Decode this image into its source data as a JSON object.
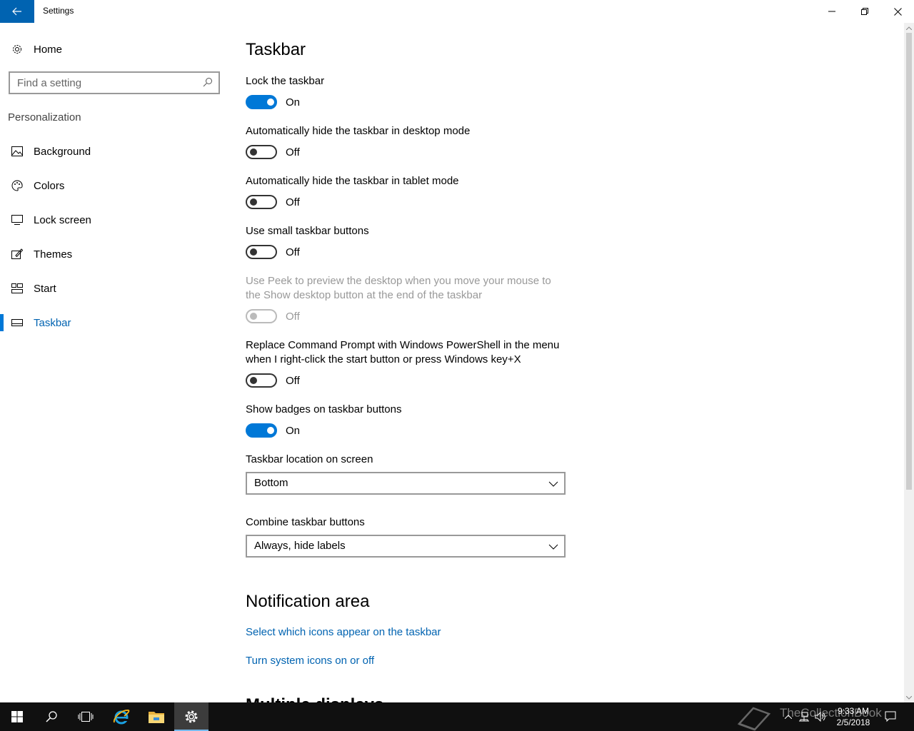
{
  "window": {
    "title": "Settings"
  },
  "sidebar": {
    "home_label": "Home",
    "search_placeholder": "Find a setting",
    "section_label": "Personalization",
    "items": [
      {
        "label": "Background",
        "icon": "image-icon"
      },
      {
        "label": "Colors",
        "icon": "palette-icon"
      },
      {
        "label": "Lock screen",
        "icon": "lock-screen-icon"
      },
      {
        "label": "Themes",
        "icon": "themes-icon"
      },
      {
        "label": "Start",
        "icon": "start-layout-icon"
      },
      {
        "label": "Taskbar",
        "icon": "taskbar-icon",
        "selected": true
      }
    ]
  },
  "main": {
    "title": "Taskbar",
    "settings": [
      {
        "label": "Lock the taskbar",
        "state": "On",
        "on": true
      },
      {
        "label": "Automatically hide the taskbar in desktop mode",
        "state": "Off",
        "on": false
      },
      {
        "label": "Automatically hide the taskbar in tablet mode",
        "state": "Off",
        "on": false
      },
      {
        "label": "Use small taskbar buttons",
        "state": "Off",
        "on": false
      },
      {
        "label": "Use Peek to preview the desktop when you move your mouse to the Show desktop button at the end of the taskbar",
        "state": "Off",
        "on": false,
        "disabled": true
      },
      {
        "label": "Replace Command Prompt with Windows PowerShell in the menu when I right-click the start button or press Windows key+X",
        "state": "Off",
        "on": false
      },
      {
        "label": "Show badges on taskbar buttons",
        "state": "On",
        "on": true
      }
    ],
    "location": {
      "label": "Taskbar location on screen",
      "value": "Bottom"
    },
    "combine": {
      "label": "Combine taskbar buttons",
      "value": "Always, hide labels"
    },
    "notification_area": {
      "title": "Notification area",
      "links": [
        "Select which icons appear on the taskbar",
        "Turn system icons on or off"
      ]
    },
    "next_section_partial": "Multiple displays"
  },
  "taskbar": {
    "apps": [
      "start-icon",
      "search-icon",
      "task-view-icon",
      "internet-explorer-icon",
      "file-explorer-icon",
      "settings-icon"
    ],
    "clock": {
      "time": "9:33 AM",
      "date": "2/5/2018"
    },
    "watermark": "TheCollectionBook"
  },
  "colors": {
    "accent": "#0078d7",
    "link": "#0063b1",
    "taskbar": "#101010"
  }
}
